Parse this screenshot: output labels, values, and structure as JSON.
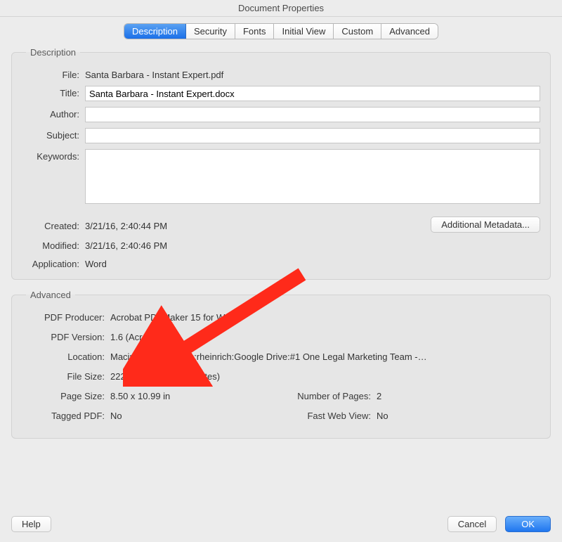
{
  "window": {
    "title": "Document Properties"
  },
  "tabs": {
    "items": [
      "Description",
      "Security",
      "Fonts",
      "Initial View",
      "Custom",
      "Advanced"
    ],
    "active": 0
  },
  "description": {
    "legend": "Description",
    "labels": {
      "file": "File:",
      "title": "Title:",
      "author": "Author:",
      "subject": "Subject:",
      "keywords": "Keywords:",
      "created": "Created:",
      "modified": "Modified:",
      "application": "Application:"
    },
    "file": "Santa Barbara - Instant Expert.pdf",
    "title_value": "Santa Barbara - Instant Expert.docx",
    "author": "",
    "subject": "",
    "keywords": "",
    "created": "3/21/16, 2:40:44 PM",
    "modified": "3/21/16, 2:40:46 PM",
    "application": "Word",
    "metadata_btn": "Additional Metadata..."
  },
  "advanced": {
    "legend": "Advanced",
    "labels": {
      "producer": "PDF Producer:",
      "version": "PDF Version:",
      "location": "Location:",
      "filesize": "File Size:",
      "pagesize": "Page Size:",
      "tagged": "Tagged PDF:",
      "numpages": "Number of Pages:",
      "fastweb": "Fast Web View:"
    },
    "producer": "Acrobat PDFMaker 15 for Word",
    "version": "1.6 (Acrobat 7.x)",
    "location": "Macintosh HD:Users:rheinrich:Google Drive:#1 One Legal Marketing Team -…",
    "filesize": "222.50 KB (227,841 Bytes)",
    "pagesize": "8.50 x 10.99 in",
    "numpages": "2",
    "tagged": "No",
    "fastweb": "No"
  },
  "buttons": {
    "help": "Help",
    "cancel": "Cancel",
    "ok": "OK"
  }
}
